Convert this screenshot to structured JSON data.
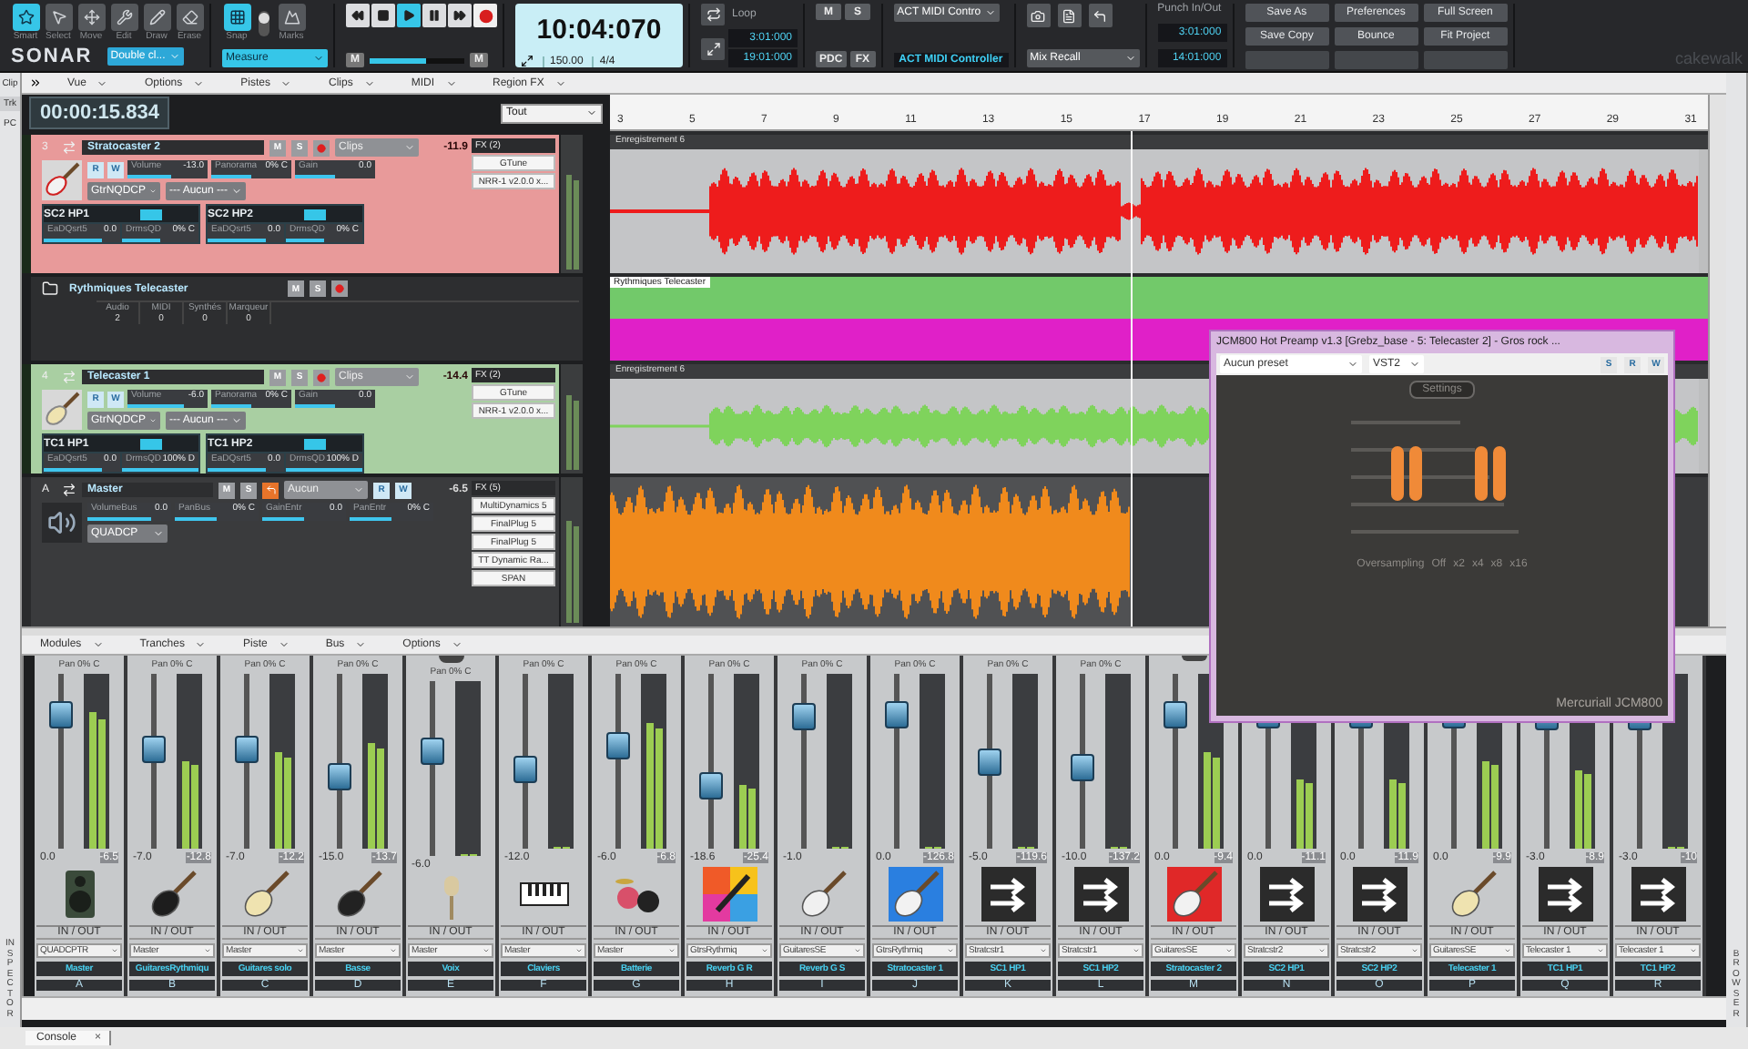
{
  "toolbar": {
    "tools": [
      {
        "label": "Smart",
        "selected": true
      },
      {
        "label": "Select",
        "selected": false
      },
      {
        "label": "Move",
        "selected": false
      },
      {
        "label": "Edit",
        "selected": false
      },
      {
        "label": "Draw",
        "selected": false
      },
      {
        "label": "Erase",
        "selected": false
      }
    ],
    "logo": "SONAR",
    "click_mode": "Double cl...",
    "snap": {
      "label": "Snap",
      "selected": true
    },
    "marks": "Marks",
    "snap_resolution": "Measure",
    "transport": [
      {
        "kind": "rewind",
        "selected": false
      },
      {
        "kind": "stop",
        "selected": false
      },
      {
        "kind": "play",
        "selected": true
      },
      {
        "kind": "pause",
        "selected": false
      },
      {
        "kind": "forward",
        "selected": false
      }
    ],
    "shuttle": {
      "buttons": [
        "M",
        "M"
      ],
      "level": 0.6
    },
    "time": "10:04:070",
    "tempo": "150.00",
    "meter": "4/4",
    "loop": {
      "label": "Loop",
      "start": "3:01:000",
      "end": "19:01:000"
    },
    "mix_buttons": [
      "M",
      "S",
      "PDC",
      "FX"
    ],
    "act_menu": "ACT MIDI Contro",
    "act_label": "ACT MIDI Controller",
    "mix_recall": "Mix Recall",
    "punch": {
      "label": "Punch In/Out",
      "start": "3:01:000",
      "end": "14:01:000"
    },
    "buttons": [
      "Save As",
      "Preferences",
      "Full Screen",
      "Save Copy",
      "Bounce",
      "Fit Project"
    ],
    "brand": "cakewalk"
  },
  "menu": [
    "Vue",
    "Options",
    "Pistes",
    "Clips",
    "MIDI",
    "Region FX"
  ],
  "left_rail": {
    "tabs": [
      {
        "label": "Clip",
        "selected": false
      },
      {
        "label": "Trk",
        "selected": true
      },
      {
        "label": "PC",
        "selected": false
      }
    ],
    "label": "INSPECTOR"
  },
  "right_rail": {
    "label": "BROWSER"
  },
  "track_view": {
    "now": "00:00:15.834",
    "filter": "Tout",
    "ruler": [
      "3",
      "5",
      "7",
      "9",
      "11",
      "13",
      "15",
      "17",
      "19",
      "21",
      "23",
      "25",
      "27",
      "29",
      "31"
    ],
    "tracks": [
      {
        "kind": "audio",
        "number": "3",
        "name": "Stratocaster 2",
        "color": "#e89a9a",
        "controls": [
          "M",
          "S"
        ],
        "clips_menu": "Clips",
        "peak": "-11.9",
        "rw": [
          "R",
          "W"
        ],
        "params": [
          {
            "label": "Volume",
            "value": "-13.0",
            "level": 0.55
          },
          {
            "label": "Panorama",
            "value": "0% C",
            "level": 0.5
          },
          {
            "label": "Gain",
            "value": "0.0",
            "level": 0.5
          }
        ],
        "input": "GtrNQDCP",
        "automation": "--- Aucun ---",
        "sends": [
          {
            "name": "SC2 HP1",
            "on": true,
            "params": [
              {
                "label": "EaDQsrt5",
                "value": "0.0",
                "level": 0.75
              },
              {
                "label": "DrmsQD",
                "value": "0% C",
                "level": 0.5
              }
            ]
          },
          {
            "name": "SC2 HP2",
            "on": true,
            "params": [
              {
                "label": "EaDQsrt5",
                "value": "0.0",
                "level": 0.75
              },
              {
                "label": "DrmsQD",
                "value": "0% C",
                "level": 0.5
              }
            ]
          }
        ],
        "fx_title": "FX (2)",
        "fx": [
          "GTune",
          "NRR-1 v2.0.0 x..."
        ],
        "clip": {
          "title": "Enregistrement 6",
          "color": "#ee1c1c"
        }
      },
      {
        "kind": "folder",
        "name": "Rythmiques Telecaster",
        "controls": [
          "M",
          "S"
        ],
        "stats": [
          {
            "label": "Audio",
            "value": "2"
          },
          {
            "label": "MIDI",
            "value": "0"
          },
          {
            "label": "Synthés",
            "value": "0"
          },
          {
            "label": "Marqueur",
            "value": "0"
          }
        ],
        "clip": {
          "title": "Rythmiques Telecaster",
          "color": "#72c96a"
        }
      },
      {
        "kind": "audio",
        "number": "4",
        "name": "Telecaster 1",
        "color": "#a9cfa2",
        "controls": [
          "M",
          "S"
        ],
        "clips_menu": "Clips",
        "peak": "-14.4",
        "rw": [
          "R",
          "W"
        ],
        "params": [
          {
            "label": "Volume",
            "value": "-6.0",
            "level": 0.7
          },
          {
            "label": "Panorama",
            "value": "0% C",
            "level": 0.5
          },
          {
            "label": "Gain",
            "value": "0.0",
            "level": 0.5
          }
        ],
        "input": "GtrNQDCP",
        "automation": "--- Aucun ---",
        "sends": [
          {
            "name": "TC1 HP1",
            "on": true,
            "params": [
              {
                "label": "EaDQsrt5",
                "value": "0.0",
                "level": 0.75
              },
              {
                "label": "DrmsQD",
                "value": "100% D",
                "level": 1
              }
            ]
          },
          {
            "name": "TC1 HP2",
            "on": true,
            "params": [
              {
                "label": "EaDQsrt5",
                "value": "0.0",
                "level": 0.75
              },
              {
                "label": "DrmsQD",
                "value": "100% D",
                "level": 1
              }
            ]
          }
        ],
        "fx_title": "FX (2)",
        "fx": [
          "GTune",
          "NRR-1 v2.0.0 x..."
        ],
        "clip": {
          "title": "Enregistrement 6",
          "color": "#7fd35c"
        }
      },
      {
        "kind": "bus",
        "number": "A",
        "name": "Master",
        "color": "#3a3b3d",
        "controls": [
          "M",
          "S"
        ],
        "automation": "Aucun",
        "rw": [
          "R",
          "W"
        ],
        "peak": "-6.5",
        "params": [
          {
            "label": "VolumeBus",
            "value": "0.0",
            "level": 0.75
          },
          {
            "label": "PanBus",
            "value": "0% C",
            "level": 0.5
          },
          {
            "label": "GainEntr",
            "value": "0.0",
            "level": 0.5
          },
          {
            "label": "PanEntr",
            "value": "0% C",
            "level": 0.5
          }
        ],
        "input": "QUADCP",
        "fx_title": "FX (5)",
        "fx": [
          "MultiDynamics 5",
          "FinalPlug 5",
          "FinalPlug 5",
          "TT Dynamic Ra...",
          "SPAN"
        ],
        "clip": {
          "color": "#f08a1c"
        }
      }
    ]
  },
  "plugin": {
    "title": "JCM800 Hot Preamp v1.3 [Grebz_base - 5: Telecaster 2] - Gros rock ...",
    "preset": "Aucun preset",
    "format": "VST2",
    "modes": [
      "S",
      "R",
      "W"
    ],
    "settings": "Settings",
    "oversampling": "Oversampling",
    "options": [
      "Off",
      "x2",
      "x4",
      "x8",
      "x16"
    ],
    "brand": "Mercuriall JCM800"
  },
  "console": {
    "menu": [
      "Modules",
      "Tranches",
      "Piste",
      "Bus",
      "Options"
    ],
    "strips": [
      {
        "name": "Master",
        "letter": "A",
        "pan": "Pan 0% C",
        "volume": "0.0",
        "peak": "-6.5",
        "kind": "speaker",
        "io": "IN / OUT",
        "output": "QUADCPTR",
        "fader": {
          "level": 0.82
        },
        "meter": {
          "level": 0.78
        }
      },
      {
        "name": "GuitaresRythmiqu",
        "letter": "B",
        "pan": "Pan 0% C",
        "volume": "-7.0",
        "peak": "-12.8",
        "kind": "guitar",
        "io": "IN / OUT",
        "output": "Master",
        "fader": {
          "level": 0.58
        },
        "meter": {
          "level": 0.5
        }
      },
      {
        "name": "Guitares solo",
        "letter": "C",
        "pan": "Pan 0% C",
        "volume": "-7.0",
        "peak": "-12.2",
        "kind": "telecaster",
        "io": "IN / OUT",
        "output": "Master",
        "fader": {
          "level": 0.58
        },
        "meter": {
          "level": 0.55
        }
      },
      {
        "name": "Basse",
        "letter": "D",
        "pan": "Pan 0% C",
        "volume": "-15.0",
        "peak": "-13.7",
        "kind": "bass",
        "io": "IN / OUT",
        "output": "Master",
        "fader": {
          "level": 0.4
        },
        "meter": {
          "level": 0.6
        }
      },
      {
        "name": "Voix",
        "letter": "E",
        "pan": "Pan 0% C",
        "volume": "-6.0",
        "kind": "microphone",
        "io": "IN / OUT",
        "output": "Master",
        "fader": {
          "level": 0.62
        },
        "meter": {
          "level": 0
        }
      },
      {
        "name": "Claviers",
        "letter": "F",
        "pan": "Pan 0% C",
        "volume": "-12.0",
        "kind": "keyboard",
        "io": "IN / OUT",
        "output": "Master",
        "fader": {
          "level": 0.45
        },
        "meter": {
          "level": 0
        }
      },
      {
        "name": "Batterie",
        "letter": "G",
        "pan": "Pan 0% C",
        "volume": "-6.0",
        "peak": "-6.8",
        "kind": "drums",
        "io": "IN / OUT",
        "output": "Master",
        "fader": {
          "level": 0.6
        },
        "meter": {
          "level": 0.72
        }
      },
      {
        "name": "Reverb G R",
        "letter": "H",
        "pan": "Pan 0% C",
        "volume": "-18.6",
        "peak": "-25.4",
        "kind": "artwork",
        "io": "IN / OUT",
        "output": "GtrsRythmiq",
        "fader": {
          "level": 0.33
        },
        "meter": {
          "level": 0.36
        }
      },
      {
        "name": "Reverb G S",
        "letter": "I",
        "pan": "Pan 0% C",
        "volume": "-1.0",
        "kind": "guitar",
        "io": "IN / OUT",
        "output": "GuitaresSE",
        "fader": {
          "level": 0.8
        },
        "meter": {
          "level": 0
        }
      },
      {
        "name": "Stratocaster 1",
        "letter": "J",
        "pan": "Pan 0% C",
        "volume": "0.0",
        "peak": "-126.8",
        "kind": "guitar",
        "color": "#2a7fe0",
        "io": "IN / OUT",
        "output": "GtrsRythmiq",
        "fader": {
          "level": 0.82
        },
        "meter": {
          "level": 0
        }
      },
      {
        "name": "SC1 HP1",
        "letter": "K",
        "pan": "Pan 0% C",
        "volume": "-5.0",
        "peak": "-119.6",
        "kind": "arrows",
        "io": "IN / OUT",
        "output": "Stratcstr1",
        "fader": {
          "level": 0.5
        },
        "meter": {
          "level": 0
        }
      },
      {
        "name": "SC1 HP2",
        "letter": "L",
        "pan": "Pan 0% C",
        "volume": "-10.0",
        "peak": "-137.2",
        "kind": "arrows",
        "io": "IN / OUT",
        "output": "Stratcstr1",
        "fader": {
          "level": 0.46
        },
        "meter": {
          "level": 0
        }
      },
      {
        "name": "Stratocaster 2",
        "letter": "M",
        "volume": "0.0",
        "peak": "-9.4",
        "kind": "guitar",
        "color": "#e02828",
        "io": "IN / OUT",
        "output": "GuitaresSE",
        "fader": {
          "level": 0.82
        },
        "meter": {
          "level": 0.55
        }
      },
      {
        "name": "SC2 HP1",
        "letter": "N",
        "volume": "0.0",
        "peak": "-11.1",
        "kind": "arrows",
        "io": "IN / OUT",
        "output": "Stratcstr2",
        "fader": {
          "level": 0.82
        },
        "meter": {
          "level": 0.4
        }
      },
      {
        "name": "SC2 HP2",
        "letter": "O",
        "volume": "0.0",
        "peak": "-11.9",
        "kind": "arrows",
        "io": "IN / OUT",
        "output": "Stratcstr2",
        "fader": {
          "level": 0.82
        },
        "meter": {
          "level": 0.4
        }
      },
      {
        "name": "Telecaster 1",
        "letter": "P",
        "volume": "0.0",
        "peak": "-9.9",
        "kind": "telecaster",
        "io": "IN / OUT",
        "output": "GuitaresSE",
        "fader": {
          "level": 0.82
        },
        "meter": {
          "level": 0.5
        }
      },
      {
        "name": "TC1 HP1",
        "letter": "Q",
        "volume": "-3.0",
        "peak": "-8.9",
        "kind": "arrows",
        "io": "IN / OUT",
        "output": "Telecaster 1",
        "fader": {
          "level": 0.8
        },
        "meter": {
          "level": 0.45
        }
      },
      {
        "name": "TC1 HP2",
        "letter": "R",
        "volume": "-3.0",
        "peak": "-10",
        "kind": "arrows",
        "io": "IN / OUT",
        "output": "Telecaster 1",
        "fader": {
          "level": 0.8
        },
        "meter": {
          "level": 0
        }
      }
    ]
  },
  "bottom_tab": {
    "label": "Console",
    "close": "×"
  }
}
